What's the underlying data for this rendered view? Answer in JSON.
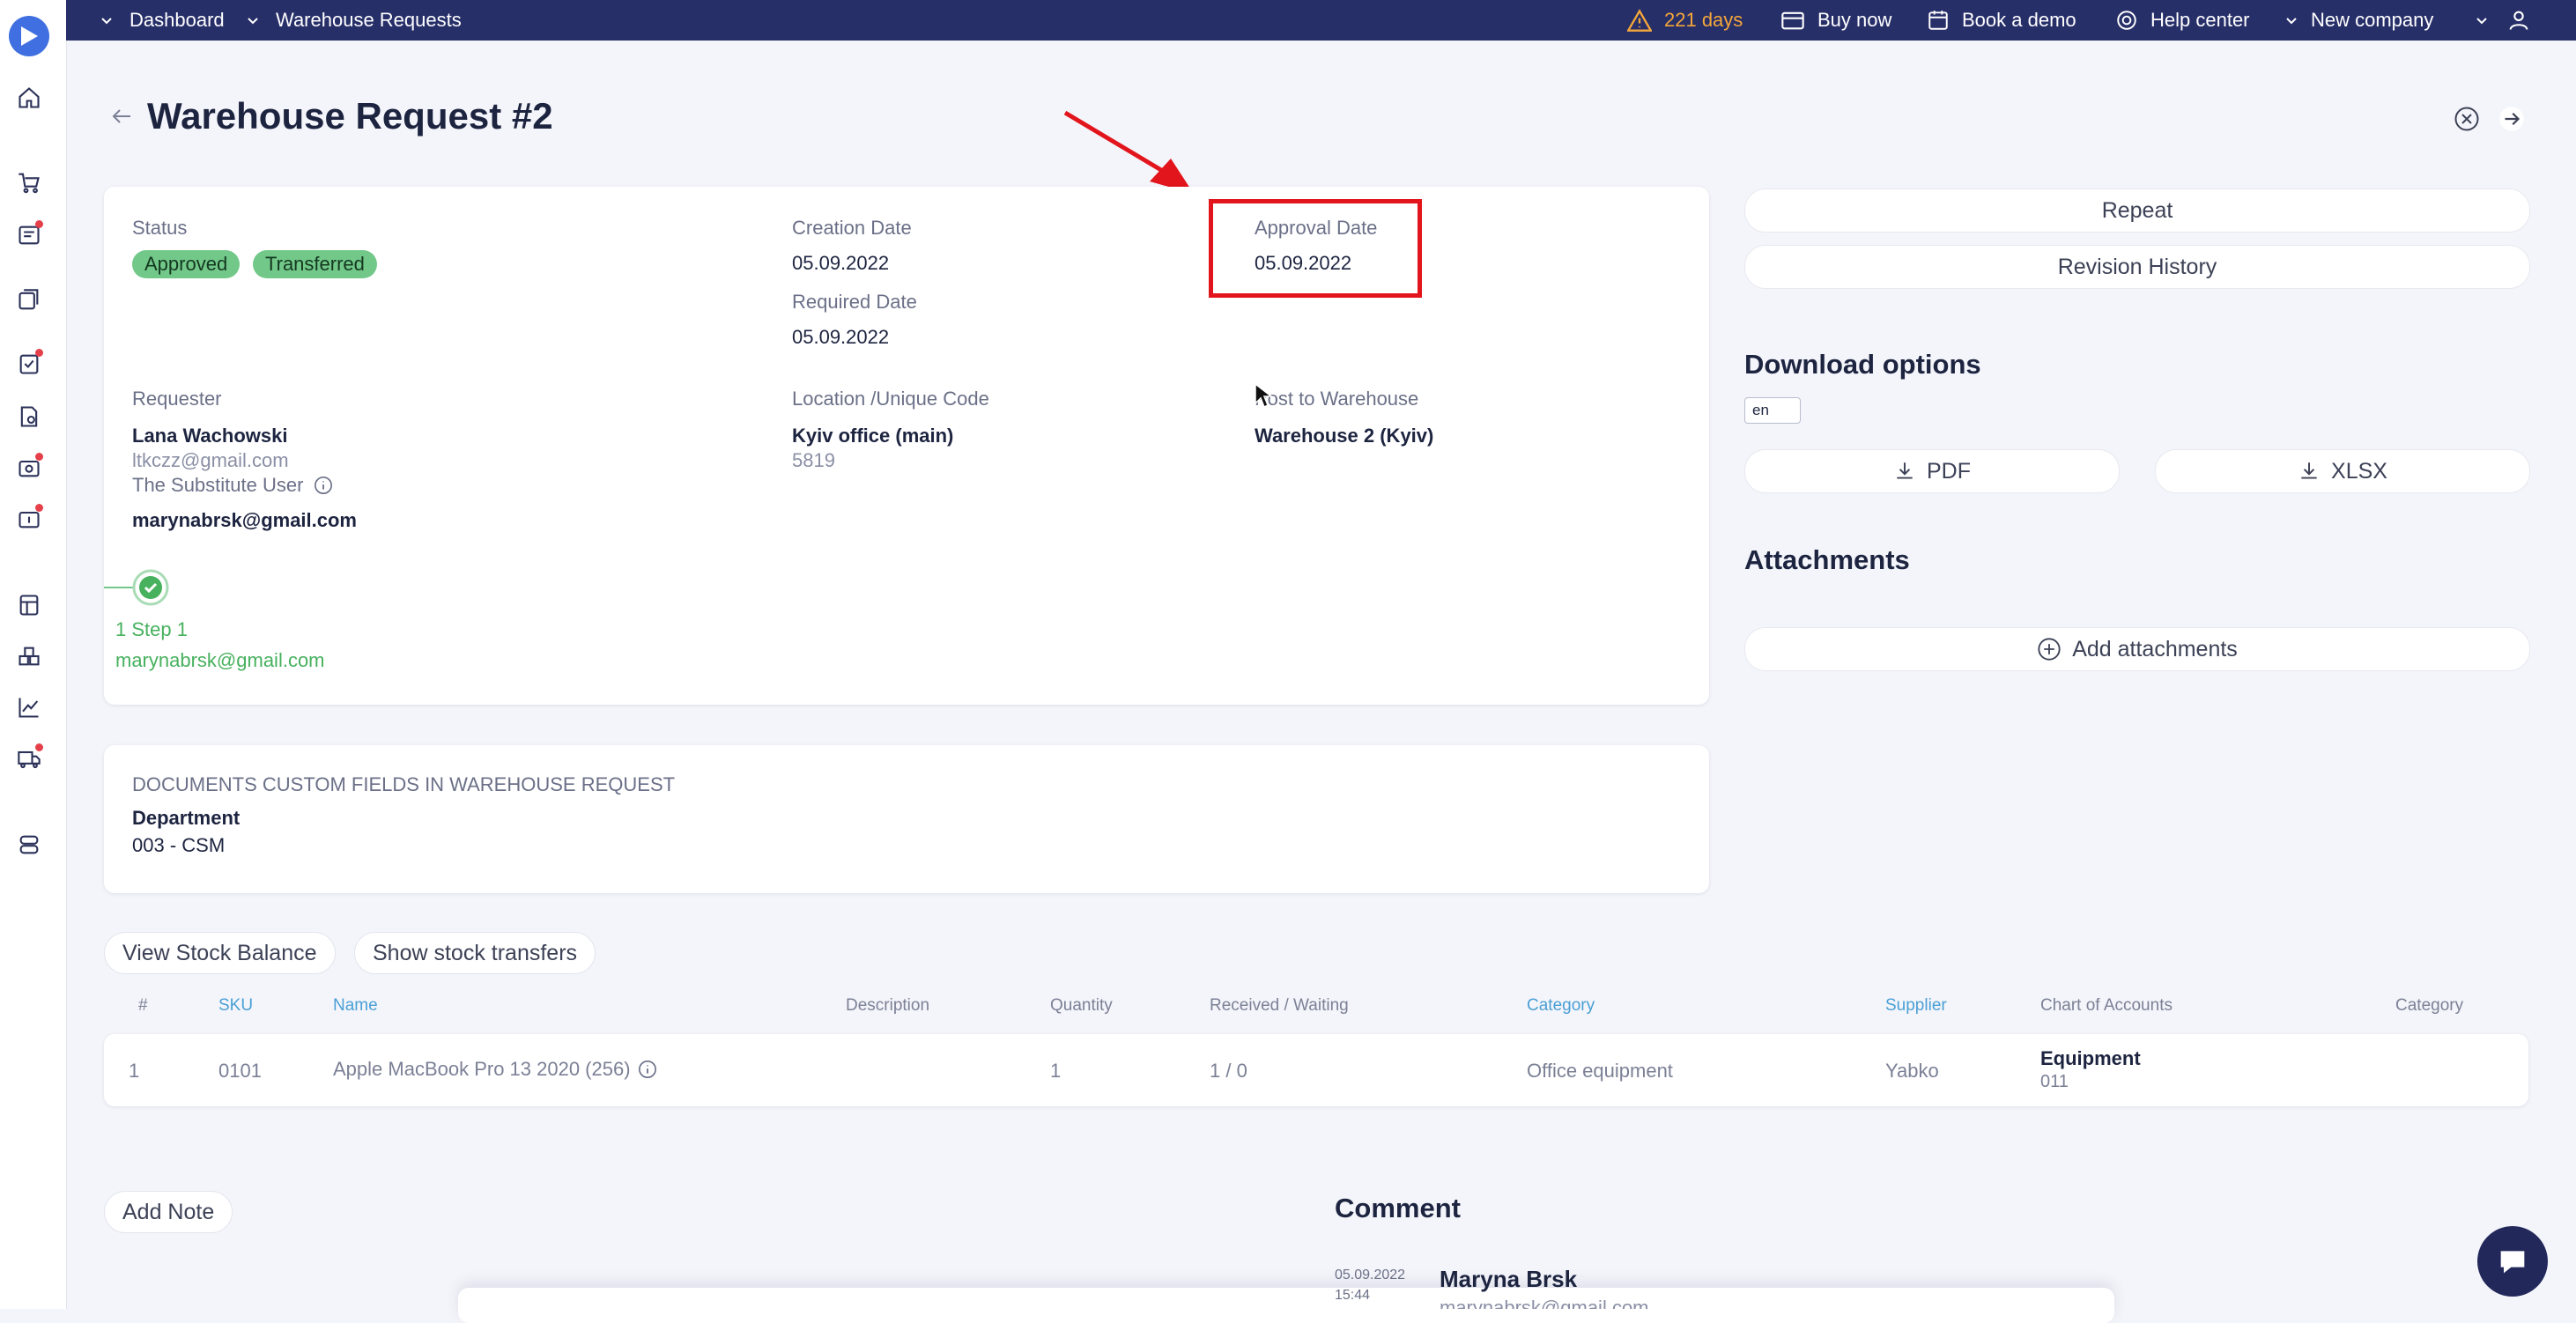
{
  "topbar": {
    "breadcrumb_dashboard": "Dashboard",
    "breadcrumb_current": "Warehouse Requests",
    "trial_days": "221 days",
    "buy_now": "Buy now",
    "book_demo": "Book a demo",
    "help_center": "Help center",
    "company": "New company"
  },
  "page": {
    "title": "Warehouse Request #2"
  },
  "info": {
    "status_label": "Status",
    "status_badges": [
      "Approved",
      "Transferred"
    ],
    "creation_date_label": "Creation Date",
    "creation_date": "05.09.2022",
    "required_date_label": "Required Date",
    "required_date": "05.09.2022",
    "approval_date_label": "Approval Date",
    "approval_date": "05.09.2022",
    "requester_label": "Requester",
    "requester_name": "Lana Wachowski",
    "requester_email": "ltkczz@gmail.com",
    "substitute_label": "The Substitute User",
    "substitute_email": "marynabrsk@gmail.com",
    "location_label": "Location /Unique Code",
    "location": "Kyiv office (main)",
    "location_code": "5819",
    "post_warehouse_label": "Post to Warehouse",
    "post_warehouse": "Warehouse 2 (Kyiv)",
    "step_label": "1 Step 1",
    "step_email": "marynabrsk@gmail.com"
  },
  "custom_fields": {
    "heading": "DOCUMENTS CUSTOM FIELDS IN WAREHOUSE REQUEST",
    "field_label": "Department",
    "field_value": "003 - CSM"
  },
  "side": {
    "repeat": "Repeat",
    "revision_history": "Revision History",
    "download_heading": "Download options",
    "language": "en",
    "pdf": "PDF",
    "xlsx": "XLSX",
    "attachments_heading": "Attachments",
    "add_attachments": "Add attachments"
  },
  "actions": {
    "view_stock": "View Stock Balance",
    "show_transfers": "Show stock transfers",
    "add_note": "Add Note"
  },
  "table": {
    "headers": [
      "#",
      "SKU",
      "Name",
      "Description",
      "Quantity",
      "Received / Waiting",
      "Category",
      "Supplier",
      "Chart of Accounts",
      "Category"
    ],
    "row": {
      "num": "1",
      "sku": "0101",
      "name": "Apple MacBook Pro 13 2020 (256)",
      "description": "",
      "quantity": "1",
      "received": "1 / 0",
      "category": "Office equipment",
      "supplier": "Yabko",
      "account_name": "Equipment",
      "account_code": "011"
    }
  },
  "comment": {
    "heading": "Comment",
    "date": "05.09.2022",
    "time": "15:44",
    "author": "Maryna Brsk",
    "author_email": "marynabrsk@gmail.com"
  },
  "colors": {
    "topbar": "#272f69",
    "badge_green": "#72c889",
    "link_blue": "#4a9fd6",
    "highlight_red": "#e2141c",
    "warning_orange": "#f4a63a"
  }
}
